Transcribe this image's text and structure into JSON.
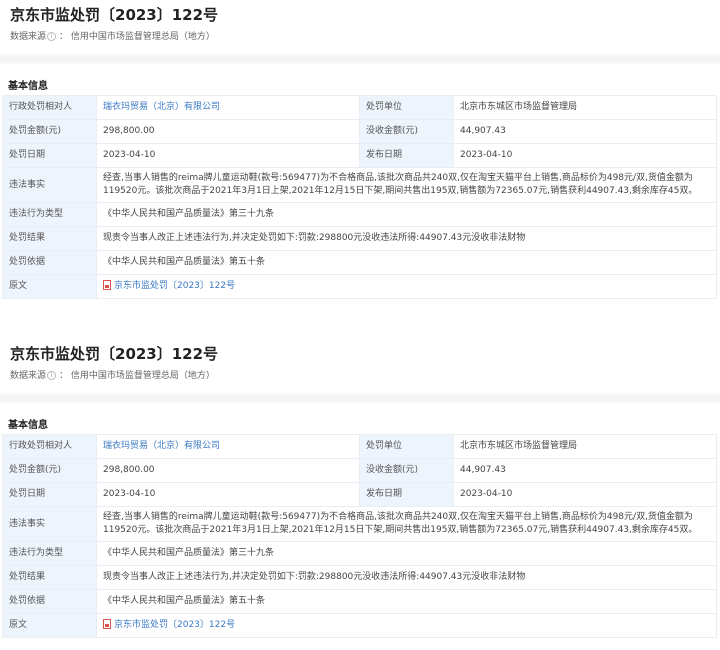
{
  "records": [
    {
      "title": "京东市监处罚〔2023〕122号",
      "source_label": "数据来源",
      "source_value": "信用中国市场监督管理总局（地方）",
      "section_title": "基本信息",
      "fields": {
        "party_label": "行政处罚相对人",
        "party_value": "瑞衣玛贸易（北京）有限公司",
        "unit_label": "处罚单位",
        "unit_value": "北京市东城区市场监督管理局",
        "amount_label": "处罚金额(元)",
        "amount_value": "298,800.00",
        "confiscated_label": "没收金额(元)",
        "confiscated_value": "44,907.43",
        "date_label": "处罚日期",
        "date_value": "2023-04-10",
        "publish_label": "发布日期",
        "publish_value": "2023-04-10",
        "facts_label": "违法事实",
        "facts_value": "经查,当事人销售的reima牌儿童运动鞋(款号:569477)为不合格商品,该批次商品共240双,仅在淘宝天猫平台上销售,商品标价为498元/双,货值金额为119520元。该批次商品于2021年3月1日上架,2021年12月15日下架,期间共售出195双,销售额为72365.07元,销售获利44907.43,剩余库存45双。",
        "type_label": "违法行为类型",
        "type_value": "《中华人民共和国产品质量法》第三十九条",
        "result_label": "处罚结果",
        "result_value": "现责令当事人改正上述违法行为,并决定处罚如下:罚款:298800元没收违法所得:44907.43元没收非法财物",
        "basis_label": "处罚依据",
        "basis_value": "《中华人民共和国产品质量法》第五十条",
        "original_label": "原文",
        "original_value": "京东市监处罚〔2023〕122号"
      }
    },
    {
      "title": "京东市监处罚〔2023〕122号",
      "source_label": "数据来源",
      "source_value": "信用中国市场监督管理总局（地方）",
      "section_title": "基本信息",
      "fields": {
        "party_label": "行政处罚相对人",
        "party_value": "瑞衣玛贸易（北京）有限公司",
        "unit_label": "处罚单位",
        "unit_value": "北京市东城区市场监督管理局",
        "amount_label": "处罚金额(元)",
        "amount_value": "298,800.00",
        "confiscated_label": "没收金额(元)",
        "confiscated_value": "44,907.43",
        "date_label": "处罚日期",
        "date_value": "2023-04-10",
        "publish_label": "发布日期",
        "publish_value": "2023-04-10",
        "facts_label": "违法事实",
        "facts_value": "经查,当事人销售的reima牌儿童运动鞋(款号:569477)为不合格商品,该批次商品共240双,仅在淘宝天猫平台上销售,商品标价为498元/双,货值金额为119520元。该批次商品于2021年3月1日上架,2021年12月15日下架,期间共售出195双,销售额为72365.07元,销售获利44907.43,剩余库存45双。",
        "type_label": "违法行为类型",
        "type_value": "《中华人民共和国产品质量法》第三十九条",
        "result_label": "处罚结果",
        "result_value": "现责令当事人改正上述违法行为,并决定处罚如下:罚款:298800元没收违法所得:44907.43元没收非法财物",
        "basis_label": "处罚依据",
        "basis_value": "《中华人民共和国产品质量法》第五十条",
        "original_label": "原文",
        "original_value": "京东市监处罚〔2023〕122号"
      }
    }
  ],
  "colors": {
    "link": "#3a78c4",
    "label_background": "#eef4fc",
    "border": "#e9eef5",
    "pdf_icon": "#d9534f"
  },
  "icons": {
    "source_info": "info-icon",
    "original_document": "pdf-icon"
  }
}
